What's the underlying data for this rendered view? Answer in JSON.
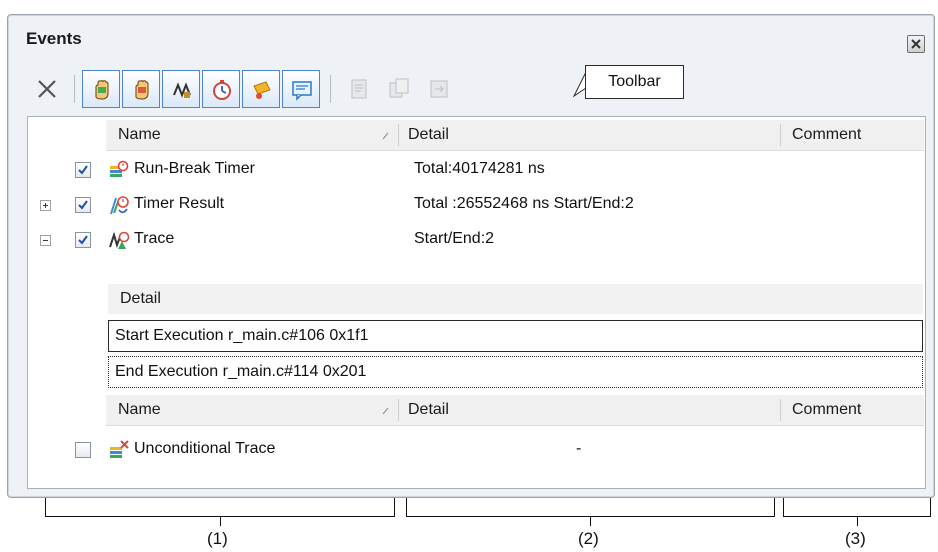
{
  "window": {
    "title": "Events"
  },
  "toolbar": {
    "callout": "Toolbar",
    "buttons": [
      {
        "name": "delete",
        "enabled": true
      },
      {
        "name": "show-hardware-break",
        "enabled": true
      },
      {
        "name": "show-software-break",
        "enabled": true
      },
      {
        "name": "show-trace",
        "enabled": true
      },
      {
        "name": "show-timer",
        "enabled": true
      },
      {
        "name": "show-action-event",
        "enabled": true
      },
      {
        "name": "show-comment",
        "enabled": true
      },
      {
        "name": "import",
        "enabled": false
      },
      {
        "name": "export",
        "enabled": false
      },
      {
        "name": "jump",
        "enabled": false
      }
    ]
  },
  "table": {
    "headers": {
      "name": "Name",
      "detail": "Detail",
      "comment": "Comment"
    },
    "rows": [
      {
        "name": "Run-Break Timer",
        "detail": "Total:40174281 ns",
        "checked": true,
        "expander": "none",
        "icon": "run-break-timer-icon"
      },
      {
        "name": "Timer Result",
        "detail": "Total :26552468 ns  Start/End:2",
        "checked": true,
        "expander": "collapsed",
        "icon": "timer-result-icon"
      },
      {
        "name": "Trace",
        "detail": "Start/End:2",
        "checked": true,
        "expander": "expanded",
        "icon": "trace-icon"
      }
    ],
    "trace_detail": {
      "header": "Detail",
      "items": [
        "Start Execution r_main.c#106 0x1f1",
        "End Execution r_main.c#114 0x201"
      ]
    },
    "headers2": {
      "name": "Name",
      "detail": "Detail",
      "comment": "Comment"
    },
    "rows2": [
      {
        "name": "Unconditional Trace",
        "detail": "-",
        "checked": false,
        "icon": "unconditional-trace-icon"
      }
    ]
  },
  "annotations": {
    "label1": "(1)",
    "label2": "(2)",
    "label3": "(3)"
  },
  "colors": {
    "accent": "#4d86d6",
    "panel_bg": "#eef1f5"
  }
}
